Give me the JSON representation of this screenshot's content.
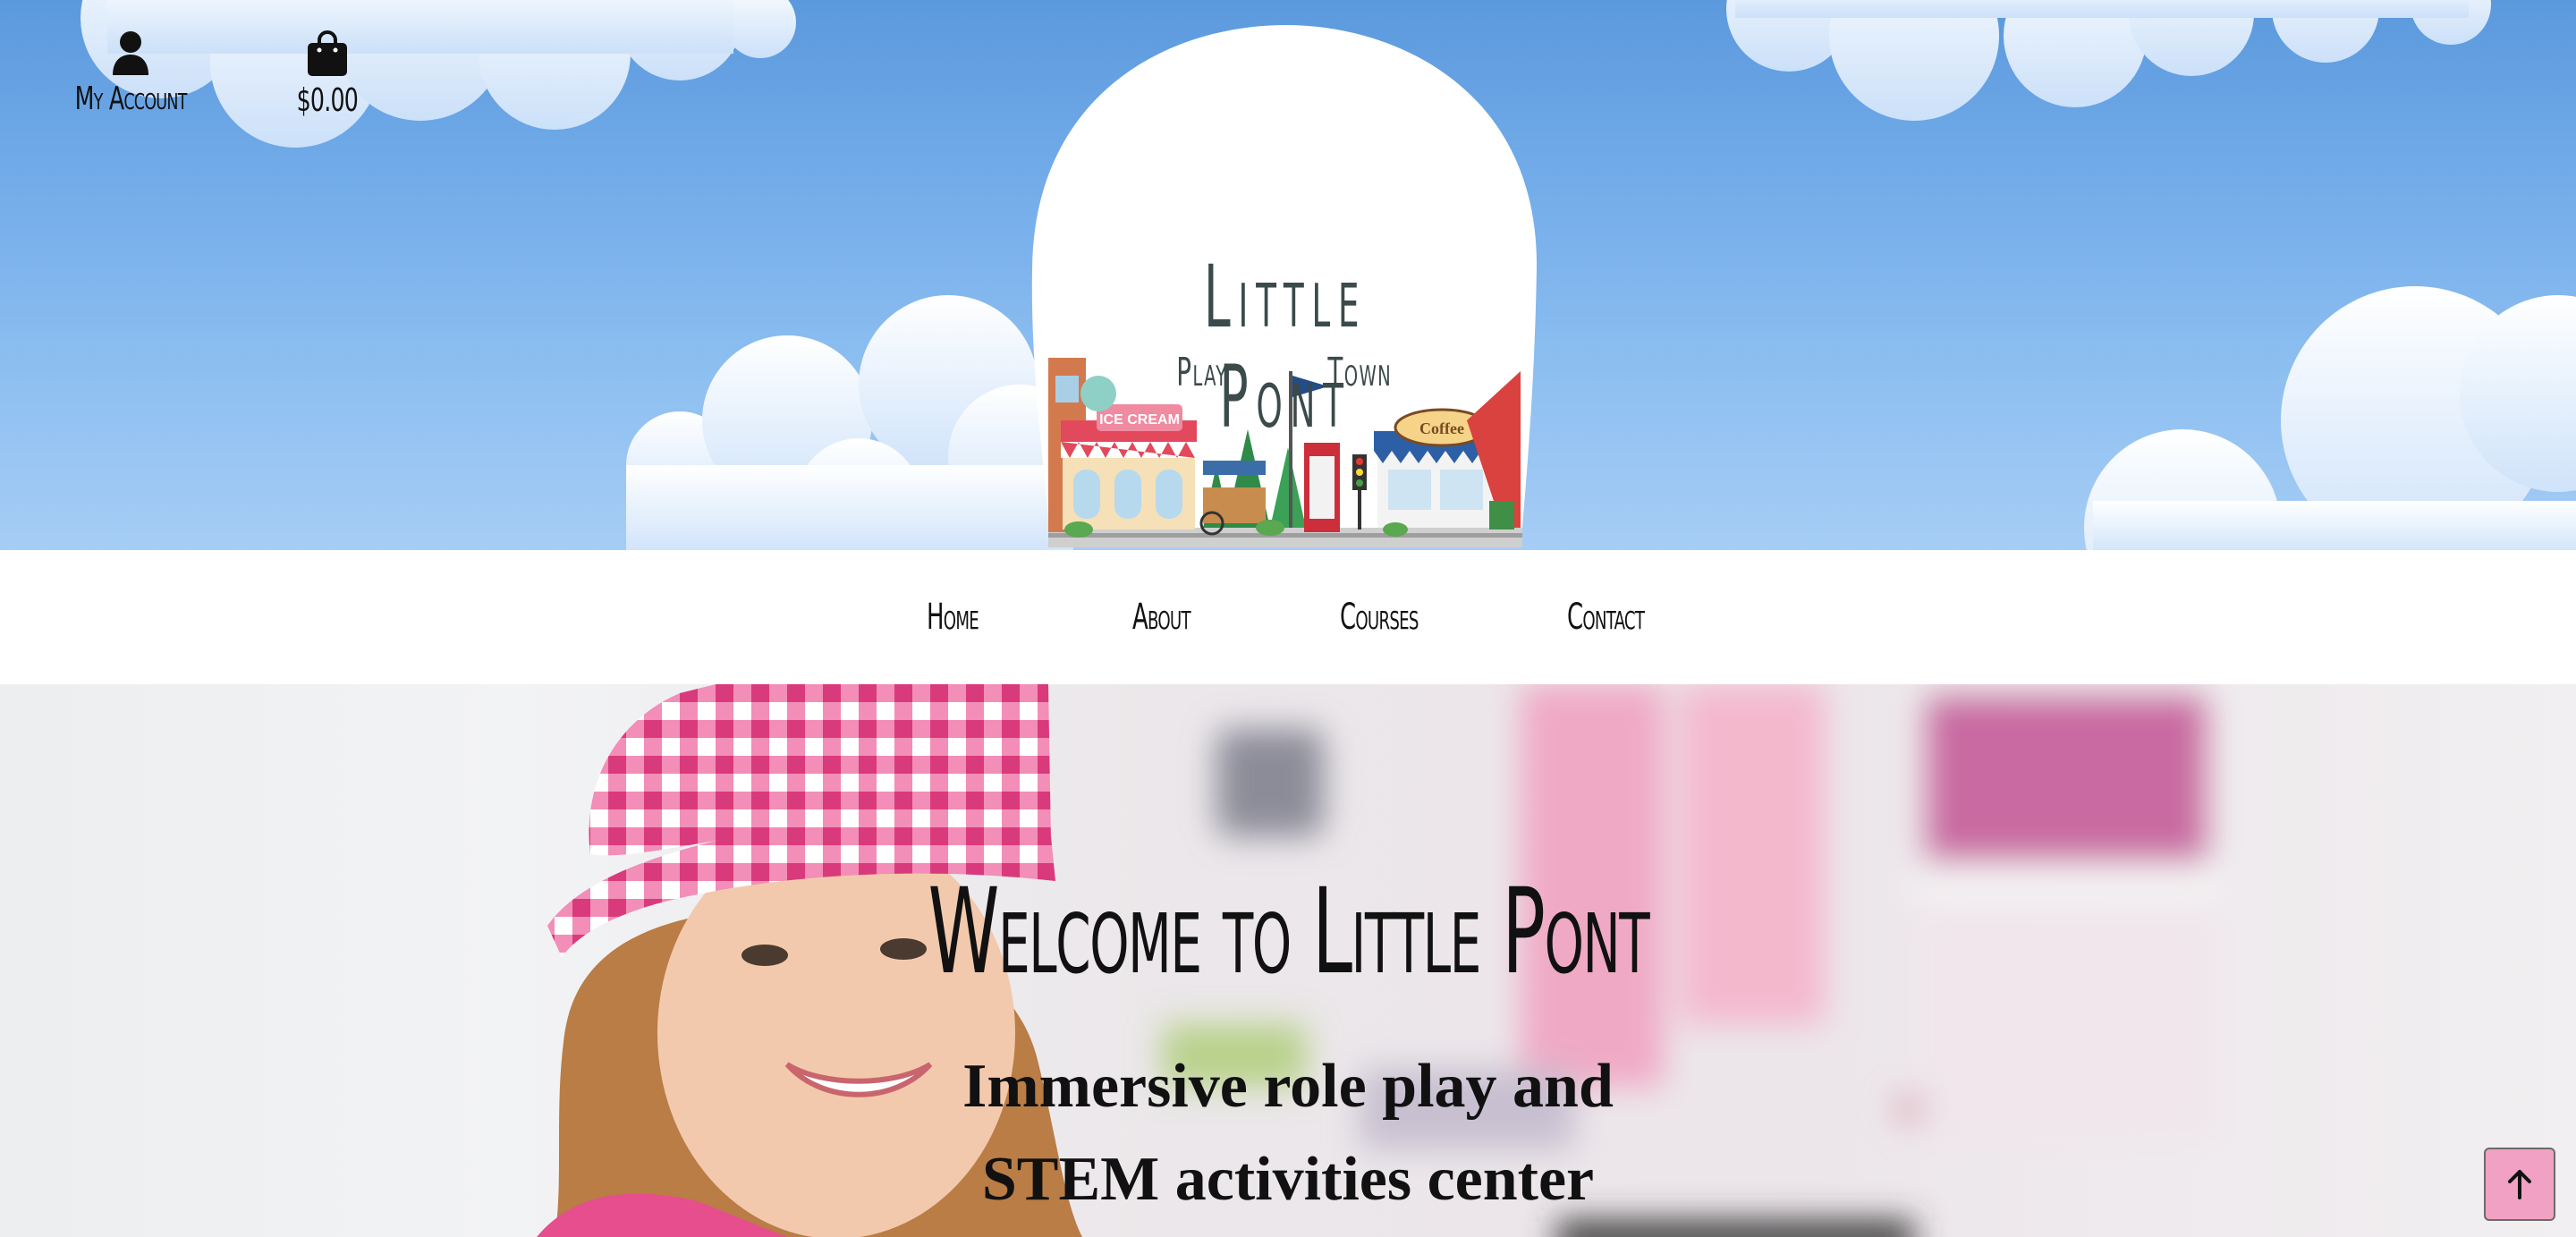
{
  "header": {
    "account_label": "My Account",
    "cart_total": "$0.00",
    "logo": {
      "title": "Little Pont",
      "subtitle_left": "Play",
      "subtitle_right": "Town",
      "sign_ice_cream": "ICE CREAM",
      "sign_coffee": "Coffee"
    }
  },
  "nav": {
    "items": [
      {
        "label": "Home"
      },
      {
        "label": "About"
      },
      {
        "label": "Courses"
      },
      {
        "label": "Contact"
      }
    ]
  },
  "hero": {
    "title": "Welcome to Little Pont",
    "subtitle_line1": "Immersive role play and",
    "subtitle_line2": "STEM activities center"
  },
  "colors": {
    "sky_top": "#5b99dd",
    "sky_bottom": "#a6cdf5",
    "back_to_top": "#f1a1c3",
    "gingham_pink": "#e64e8d"
  },
  "icons": {
    "account": "user-icon",
    "cart": "shopping-bag-icon",
    "back_to_top": "arrow-up-icon"
  }
}
